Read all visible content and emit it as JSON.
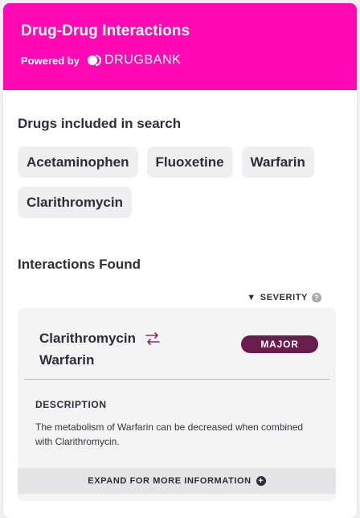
{
  "header": {
    "title": "Drug-Drug Interactions",
    "powered_by": "Powered by",
    "brand_name": "DRUGBANK",
    "brand_color": "#ff09b5"
  },
  "drugs_section": {
    "title": "Drugs included in search",
    "chips": [
      {
        "label": "Acetaminophen"
      },
      {
        "label": "Fluoxetine"
      },
      {
        "label": "Warfarin"
      },
      {
        "label": "Clarithromycin"
      }
    ]
  },
  "interactions_section": {
    "title": "Interactions Found",
    "sort_label": "SEVERITY",
    "sort_icon": "triangle-down",
    "help_icon": "question-circle",
    "items": [
      {
        "drug_a": "Clarithromycin",
        "drug_b": "Warfarin",
        "swap_icon": "arrows-swap-icon",
        "severity": "MAJOR",
        "severity_color": "#6b1d4e",
        "description_label": "DESCRIPTION",
        "description": "The metabolism of Warfarin can be decreased when combined with Clarithromycin.",
        "expand_label": "EXPAND FOR MORE INFORMATION",
        "expand_icon": "plus-circle"
      }
    ]
  }
}
